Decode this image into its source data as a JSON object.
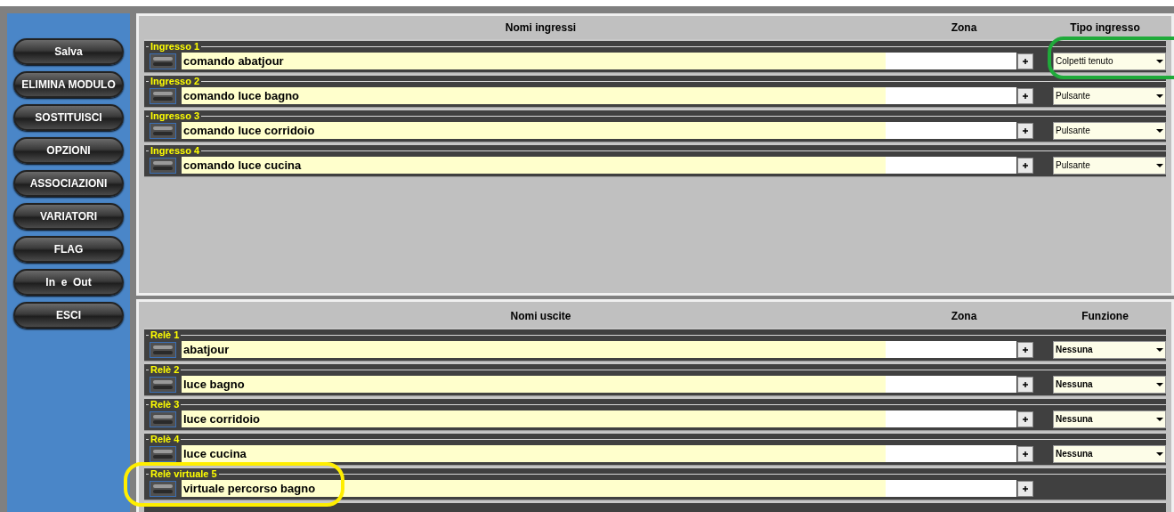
{
  "sidebar": {
    "buttons": [
      "Salva",
      "ELIMINA MODULO",
      "SOSTITUISCI",
      "OPZIONI",
      "ASSOCIAZIONI",
      "VARIATORI",
      "FLAG",
      "In  e  Out",
      "ESCI"
    ]
  },
  "inputs": {
    "columns": [
      "Nomi ingressi",
      "Zona",
      "Tipo ingresso"
    ],
    "rows": [
      {
        "label": "Ingresso 1",
        "name": "comando abatjour",
        "type": "Colpetti tenuto"
      },
      {
        "label": "Ingresso 2",
        "name": "comando luce bagno",
        "type": "Pulsante"
      },
      {
        "label": "Ingresso 3",
        "name": "comando luce corridoio",
        "type": "Pulsante"
      },
      {
        "label": "Ingresso 4",
        "name": "comando luce cucina",
        "type": "Pulsante"
      }
    ]
  },
  "outputs": {
    "columns": [
      "Nomi uscite",
      "Zona",
      "Funzione"
    ],
    "rows": [
      {
        "label": "Relè 1",
        "name": "abatjour",
        "type": "Nessuna"
      },
      {
        "label": "Relè 2",
        "name": "luce bagno",
        "type": "Nessuna"
      },
      {
        "label": "Relè 3",
        "name": "luce corridoio",
        "type": "Nessuna"
      },
      {
        "label": "Relè 4",
        "name": "luce cucina",
        "type": "Nessuna"
      },
      {
        "label": "Relè virtuale 5",
        "name": "virtuale percorso bagno"
      }
    ]
  }
}
